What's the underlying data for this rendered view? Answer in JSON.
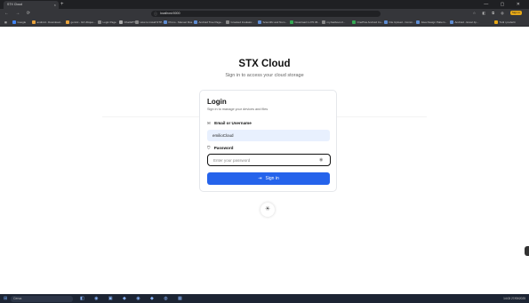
{
  "browser": {
    "tab_title": "STX Cloud",
    "tab_close": "×",
    "new_tab": "+",
    "window_controls": "—  ▢  ✕",
    "nav_buttons": "← → ⟳",
    "url": "localhost:5000",
    "ext_badge": "Sign in",
    "bookmarks": [
      "Google",
      "android - Download...",
      "gemini - Gli Ubiquo...",
      "Login Page",
      "ChatGPT",
      "How to install NTP...",
      "Prono - Manuel Ros...",
      "Android Tree Page...",
      "Grooked Insulator...",
      "Scientific and Num...",
      "Download 1.270.36...",
      "my.fastboot.cl...",
      "OnePlus Android Co...",
      "File Upload - Comm...",
      "Java Design Pattern...",
      "Android - Excel Jp..."
    ],
    "all_bookmarks": "Tutti i preferiti"
  },
  "page": {
    "app_title": "STX Cloud",
    "app_subtitle": "Sign in to access your cloud storage",
    "card_title": "Login",
    "card_subtitle": "Sign in to manage your devices and files",
    "username_label": "Email or Username",
    "username_value": "emilioCloud",
    "password_label": "Password",
    "password_placeholder": "Enter your password",
    "signin_label": "Sign in"
  },
  "icons": {
    "user": "✉",
    "lock": "🔒",
    "eye": "◉",
    "signin": "⇥",
    "theme": "☀"
  },
  "taskbar": {
    "search_placeholder": "Cerca",
    "tray": "14:03  27/05/2025"
  },
  "colors": {
    "accent": "#2563eb",
    "input_fill": "#e8f0fe"
  }
}
